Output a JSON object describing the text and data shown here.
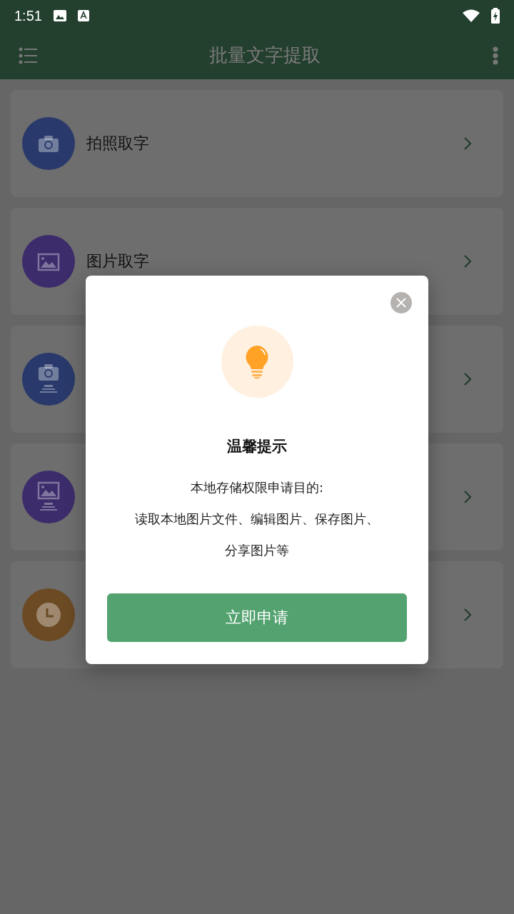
{
  "status_bar": {
    "time": "1:51"
  },
  "header": {
    "title": "批量文字提取"
  },
  "items": [
    {
      "kind": "camera",
      "color": "#29396b",
      "label": "拍照取字"
    },
    {
      "kind": "picture",
      "color": "#3d2c6b",
      "label": "图片取字"
    },
    {
      "kind": "camera-stand",
      "color": "#29396b"
    },
    {
      "kind": "picture-stand",
      "color": "#3d2c6b"
    },
    {
      "kind": "clock",
      "color": "#6b4a24"
    }
  ],
  "dialog": {
    "title": "温馨提示",
    "lines": [
      "本地存储权限申请目的:",
      "读取本地图片文件、编辑图片、保存图片、",
      "分享图片等"
    ],
    "button": "立即申请"
  }
}
